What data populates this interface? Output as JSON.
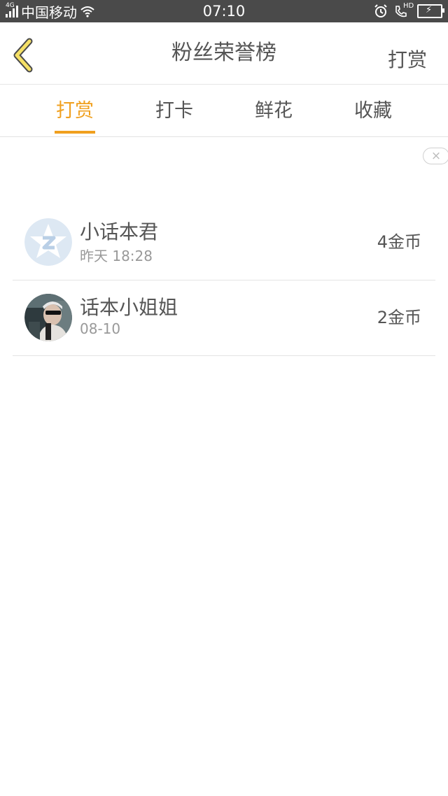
{
  "status_bar": {
    "network": "4G",
    "carrier": "中国移动",
    "time": "07:10",
    "hd_label": "HD",
    "battery_color": "#2ed35a"
  },
  "nav": {
    "title": "粉丝荣誉榜",
    "action_label": "打赏",
    "back_icon": "chevron-left-icon"
  },
  "tabs": [
    {
      "label": "打赏",
      "active": true
    },
    {
      "label": "打卡",
      "active": false
    },
    {
      "label": "鲜花",
      "active": false
    },
    {
      "label": "收藏",
      "active": false
    }
  ],
  "accent_color": "#f0a01f",
  "close_label": "×",
  "list": [
    {
      "name": "小话本君",
      "time": "昨天 18:28",
      "coins": "4金币",
      "avatar": "qq-default-avatar"
    },
    {
      "name": "话本小姐姐",
      "time": "08-10",
      "coins": "2金币",
      "avatar": "photo-avatar"
    }
  ]
}
